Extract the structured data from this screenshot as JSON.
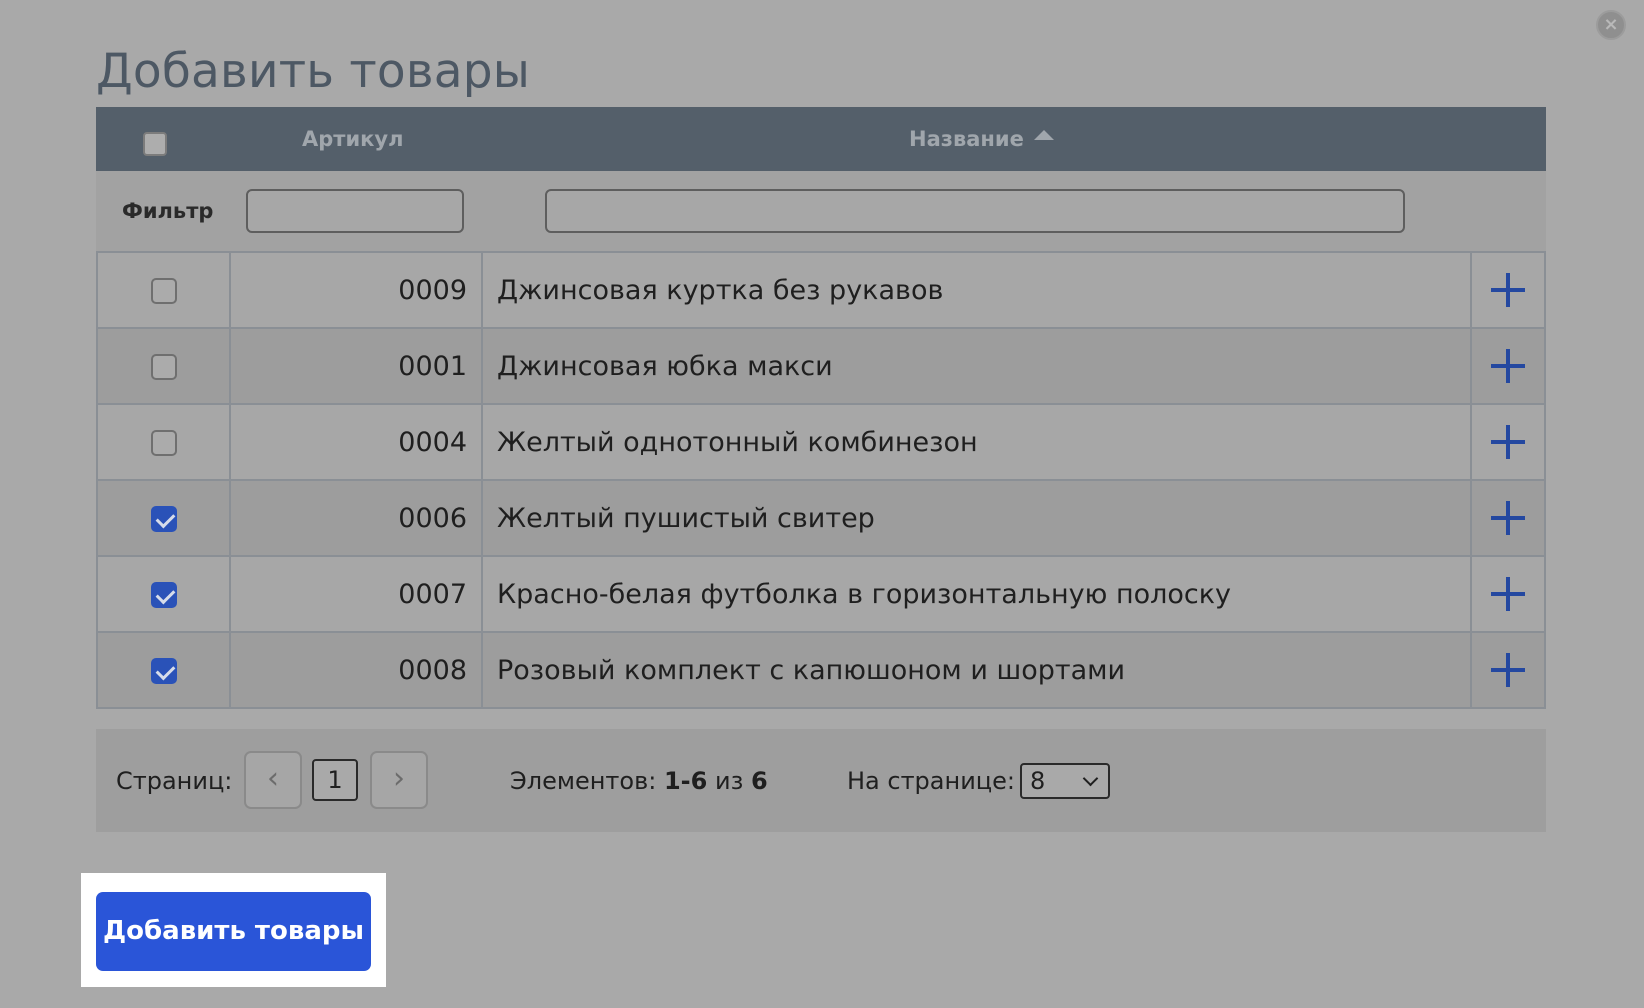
{
  "dialog": {
    "title": "Добавить товары",
    "close_icon": "close-icon"
  },
  "table": {
    "columns": {
      "sku": "Артикул",
      "name": "Название",
      "sort": "ascending"
    },
    "filter_label": "Фильтр",
    "filter_sku_value": "",
    "filter_name_value": "",
    "rows": [
      {
        "checked": false,
        "sku": "0009",
        "name": "Джинсовая куртка без рукавов"
      },
      {
        "checked": false,
        "sku": "0001",
        "name": "Джинсовая юбка макси"
      },
      {
        "checked": false,
        "sku": "0004",
        "name": "Желтый однотонный комбинезон"
      },
      {
        "checked": true,
        "sku": "0006",
        "name": "Желтый пушистый свитер"
      },
      {
        "checked": true,
        "sku": "0007",
        "name": "Красно-белая футболка в горизонтальную полоску"
      },
      {
        "checked": true,
        "sku": "0008",
        "name": "Розовый комплект с капюшоном и шортами"
      }
    ]
  },
  "pager": {
    "pages_label": "Страниц:",
    "prev_icon": "chevron-left-icon",
    "current_page": "1",
    "next_icon": "chevron-right-icon",
    "items_label": "Элементов:",
    "items_range": "1-6",
    "items_of": "из",
    "items_total": "6",
    "per_page_label": "На странице:",
    "per_page_value": "8"
  },
  "actions": {
    "add_button_label": "Добавить товары"
  },
  "colors": {
    "accent": "#2a55d8",
    "header_bg": "#545f6a",
    "plus_icon": "#2448a0"
  }
}
